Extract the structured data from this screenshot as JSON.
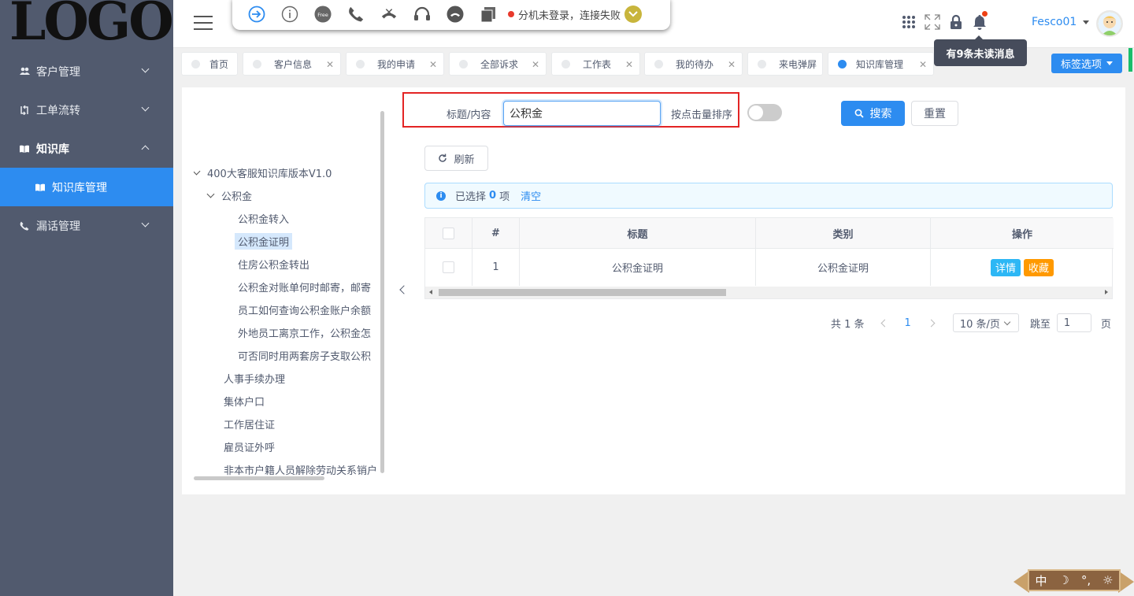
{
  "logo": {
    "text": "LOGO"
  },
  "sidebar": {
    "items": [
      {
        "label": "客户管理"
      },
      {
        "label": "工单流转"
      },
      {
        "label": "知识库"
      },
      {
        "label": "知识库管理"
      },
      {
        "label": "漏话管理"
      }
    ]
  },
  "toolbar": {
    "free_label": "Free",
    "status_text": "分机未登录，连接失败"
  },
  "header": {
    "user_name": "Fesco01",
    "tooltip": "有9条未读消息"
  },
  "tabs": [
    {
      "label": "首页"
    },
    {
      "label": "客户信息"
    },
    {
      "label": "我的申请"
    },
    {
      "label": "全部诉求"
    },
    {
      "label": "工作表"
    },
    {
      "label": "我的待办"
    },
    {
      "label": "来电弹屏"
    },
    {
      "label": "知识库管理"
    }
  ],
  "tab_options": {
    "label": "标签选项"
  },
  "tree": {
    "nodes": [
      {
        "label": "400大客服知识库版本V1.0"
      },
      {
        "label": "公积金"
      },
      {
        "label": "公积金转入"
      },
      {
        "label": "公积金证明"
      },
      {
        "label": "住房公积金转出"
      },
      {
        "label": "公积金对账单何时邮寄，邮寄"
      },
      {
        "label": "员工如何查询公积金账户余额"
      },
      {
        "label": "外地员工离京工作，公积金怎"
      },
      {
        "label": "可否同时用两套房子支取公积"
      },
      {
        "label": "人事手续办理"
      },
      {
        "label": "集体户口"
      },
      {
        "label": "工作居住证"
      },
      {
        "label": "雇员证外呼"
      },
      {
        "label": "非本市户籍人员解除劳动关系销户"
      }
    ]
  },
  "search": {
    "label": "标题/内容",
    "value": "公积金",
    "sort_label": "按点击量排序",
    "search_button": "搜索",
    "reset_button": "重置"
  },
  "refresh_button": "刷新",
  "alert": {
    "prefix": "已选择",
    "count": "0",
    "suffix": "项",
    "clear": "清空"
  },
  "table": {
    "headers": {
      "index": "#",
      "title": "标题",
      "category": "类别",
      "action": "操作"
    },
    "rows": [
      {
        "index": "1",
        "title": "公积金证明",
        "category": "公积金证明",
        "detail": "详情",
        "favorite": "收藏"
      }
    ]
  },
  "pager": {
    "total": "共 1 条",
    "current": "1",
    "page_size": "10 条/页",
    "jump_label": "跳至",
    "jump_value": "1",
    "page_suffix": "页"
  },
  "widget": {
    "items": [
      "中",
      "☽",
      "°,",
      "☼"
    ]
  },
  "colors": {
    "primary": "#2d8cf0",
    "sidebar": "#515a6e",
    "detail": "#2db7f5",
    "favorite": "#ff9900",
    "highlight": "#e32424"
  }
}
